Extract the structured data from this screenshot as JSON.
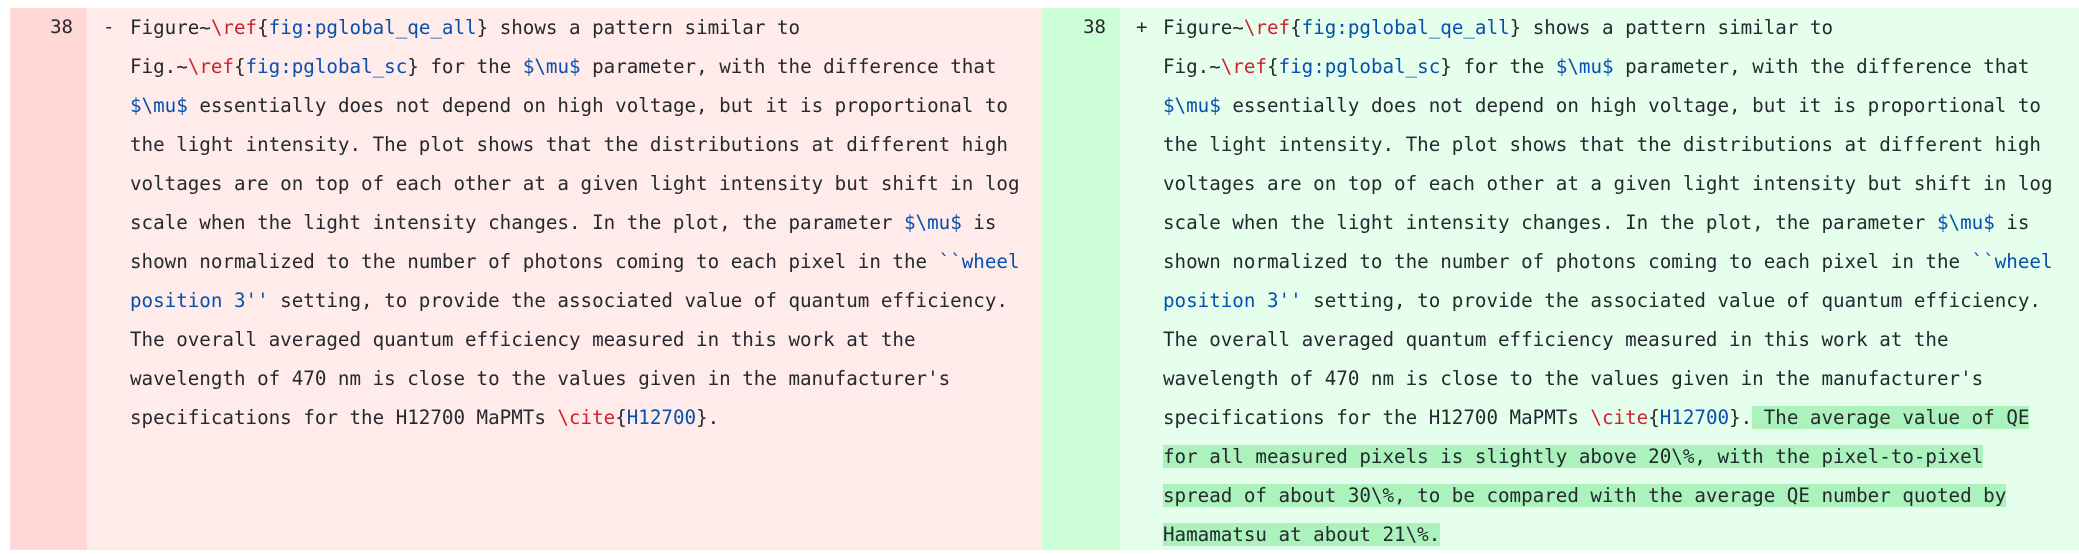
{
  "left": {
    "line_number": "38",
    "marker": "-",
    "lines": [
      [
        {
          "t": "Figure~"
        },
        {
          "t": "\\ref",
          "c": "cmd"
        },
        {
          "t": "{"
        },
        {
          "t": "fig:pglobal_qe_all",
          "c": "arg"
        },
        {
          "t": "} shows a pattern similar to"
        }
      ],
      [
        {
          "t": "Fig.~"
        },
        {
          "t": "\\ref",
          "c": "cmd"
        },
        {
          "t": "{"
        },
        {
          "t": "fig:pglobal_sc",
          "c": "arg"
        },
        {
          "t": "} for the "
        },
        {
          "t": "$\\mu$",
          "c": "arg"
        },
        {
          "t": " parameter, with the difference that"
        }
      ],
      [
        {
          "t": "$\\mu$",
          "c": "arg"
        },
        {
          "t": " essentially does not depend on high voltage, but it is proportional to"
        }
      ],
      [
        {
          "t": "the light intensity. The plot shows that the distributions at different high"
        }
      ],
      [
        {
          "t": "voltages are on top of each other at a given light intensity but shift in log"
        }
      ],
      [
        {
          "t": "scale when the light intensity changes. In the plot, the parameter "
        },
        {
          "t": "$\\mu$",
          "c": "arg"
        },
        {
          "t": " is"
        }
      ],
      [
        {
          "t": "shown normalized to the number of photons coming to each pixel in the "
        },
        {
          "t": "``wheel",
          "c": "arg"
        }
      ],
      [
        {
          "t": "position 3''",
          "c": "arg"
        },
        {
          "t": " setting, to provide the associated value of quantum efficiency."
        }
      ],
      [
        {
          "t": "The overall averaged quantum efficiency measured in this work at the"
        }
      ],
      [
        {
          "t": "wavelength of 470 nm is close to the values given in the manufacturer's"
        }
      ],
      [
        {
          "t": "specifications for the H12700 MaPMTs "
        },
        {
          "t": "\\cite",
          "c": "cmd"
        },
        {
          "t": "{"
        },
        {
          "t": "H12700",
          "c": "arg"
        },
        {
          "t": "}."
        }
      ]
    ]
  },
  "right": {
    "line_number": "38",
    "marker": "+",
    "lines": [
      [
        {
          "t": "Figure~"
        },
        {
          "t": "\\ref",
          "c": "cmd"
        },
        {
          "t": "{"
        },
        {
          "t": "fig:pglobal_qe_all",
          "c": "arg"
        },
        {
          "t": "} shows a pattern similar to"
        }
      ],
      [
        {
          "t": "Fig.~"
        },
        {
          "t": "\\ref",
          "c": "cmd"
        },
        {
          "t": "{"
        },
        {
          "t": "fig:pglobal_sc",
          "c": "arg"
        },
        {
          "t": "} for the "
        },
        {
          "t": "$\\mu$",
          "c": "arg"
        },
        {
          "t": " parameter, with the difference that"
        }
      ],
      [
        {
          "t": "$\\mu$",
          "c": "arg"
        },
        {
          "t": " essentially does not depend on high voltage, but it is proportional to"
        }
      ],
      [
        {
          "t": "the light intensity. The plot shows that the distributions at different high"
        }
      ],
      [
        {
          "t": "voltages are on top of each other at a given light intensity but shift in log"
        }
      ],
      [
        {
          "t": "scale when the light intensity changes. In the plot, the parameter "
        },
        {
          "t": "$\\mu$",
          "c": "arg"
        },
        {
          "t": " is"
        }
      ],
      [
        {
          "t": "shown normalized to the number of photons coming to each pixel in the "
        },
        {
          "t": "``wheel",
          "c": "arg"
        }
      ],
      [
        {
          "t": "position 3''",
          "c": "arg"
        },
        {
          "t": " setting, to provide the associated value of quantum efficiency."
        }
      ],
      [
        {
          "t": "The overall averaged quantum efficiency measured in this work at the"
        }
      ],
      [
        {
          "t": "wavelength of 470 nm is close to the values given in the manufacturer's"
        }
      ],
      [
        {
          "t": "specifications for the H12700 MaPMTs "
        },
        {
          "t": "\\cite",
          "c": "cmd"
        },
        {
          "t": "{"
        },
        {
          "t": "H12700",
          "c": "arg"
        },
        {
          "t": "}."
        },
        {
          "t": " The average value of QE ",
          "c": "hl"
        }
      ],
      [
        {
          "t": "for all measured pixels is slightly above 20\\%, with the pixel-to-pixel ",
          "c": "hl"
        }
      ],
      [
        {
          "t": "spread of about 30\\%, to be compared with the average QE number quoted by ",
          "c": "hl"
        }
      ],
      [
        {
          "t": "Hamamatsu at about 21\\%. ",
          "c": "hl"
        }
      ]
    ]
  },
  "colors": {
    "deleted_line_bg": "#ffebe9",
    "deleted_gutter_bg": "#ffd7d5",
    "added_line_bg": "#e6ffec",
    "added_gutter_bg": "#ccffd8",
    "added_word_highlight": "#abf2bc",
    "latex_command": "#cf222e",
    "latex_argument": "#0550ae"
  }
}
